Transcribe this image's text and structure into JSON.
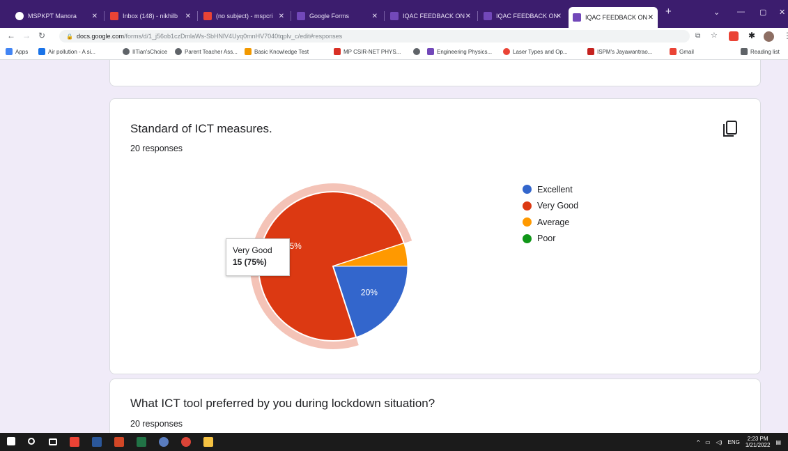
{
  "browser": {
    "tabs": [
      {
        "label": "MSPKPT Manora",
        "icon": "chrome-icon",
        "active": false
      },
      {
        "label": "Inbox (148) - nikhilb",
        "icon": "gmail-icon",
        "active": false
      },
      {
        "label": "(no subject) - mspcri",
        "icon": "gmail-icon",
        "active": false
      },
      {
        "label": "Google Forms",
        "icon": "forms-icon",
        "active": false
      },
      {
        "label": "IQAC FEEDBACK ON",
        "icon": "forms-icon",
        "active": false
      },
      {
        "label": "IQAC FEEDBACK ON",
        "icon": "forms-icon",
        "active": false
      },
      {
        "label": "IQAC FEEDBACK ON",
        "icon": "forms-icon",
        "active": true
      }
    ],
    "url_host": "docs.google.com",
    "url_path": "/forms/d/1_j56ob1czDmlaWs-SbHNlV4Uyq0mnHV7040tqplv_c/edit#responses",
    "bookmarks": [
      {
        "label": "Apps",
        "icon": "apps-icon"
      },
      {
        "label": "Air pollution - A si...",
        "icon": "bookmark-icon"
      },
      {
        "label": "IITian'sChoice",
        "icon": "globe-icon"
      },
      {
        "label": "Parent Teacher Ass...",
        "icon": "globe-icon"
      },
      {
        "label": "Basic Knowledge Test",
        "icon": "bookmark-icon"
      },
      {
        "label": "MP CSIR-NET PHYS...",
        "icon": "bookmark-icon"
      },
      {
        "label": "",
        "icon": "globe-icon"
      },
      {
        "label": "Engineering Physics...",
        "icon": "forms-icon"
      },
      {
        "label": "Laser Types and Op...",
        "icon": "bookmark-icon"
      },
      {
        "label": "ISPM's Jayawantrao...",
        "icon": "bookmark-icon"
      },
      {
        "label": "Gmail",
        "icon": "gmail-icon"
      },
      {
        "label": "Reading list",
        "icon": "reading-list-icon"
      }
    ]
  },
  "questions": [
    {
      "title": "Standard of ICT measures.",
      "responses": "20 responses",
      "tooltip": {
        "label": "Very Good",
        "value": "15 (75%)"
      }
    },
    {
      "title": "What ICT tool preferred by you during lockdown situation?",
      "responses": "20 responses"
    }
  ],
  "chart_data": {
    "type": "pie",
    "categories": [
      "Excellent",
      "Very Good",
      "Average",
      "Poor"
    ],
    "values": [
      4,
      15,
      1,
      0
    ],
    "percent_labels": [
      "20%",
      "75%",
      "",
      ""
    ],
    "colors": [
      "#3366cc",
      "#dc3912",
      "#ff9900",
      "#109618"
    ],
    "highlighted": "Very Good",
    "legend_position": "right"
  },
  "taskbar": {
    "lang": "ENG",
    "time": "2:23 PM",
    "date": "1/21/2022"
  }
}
